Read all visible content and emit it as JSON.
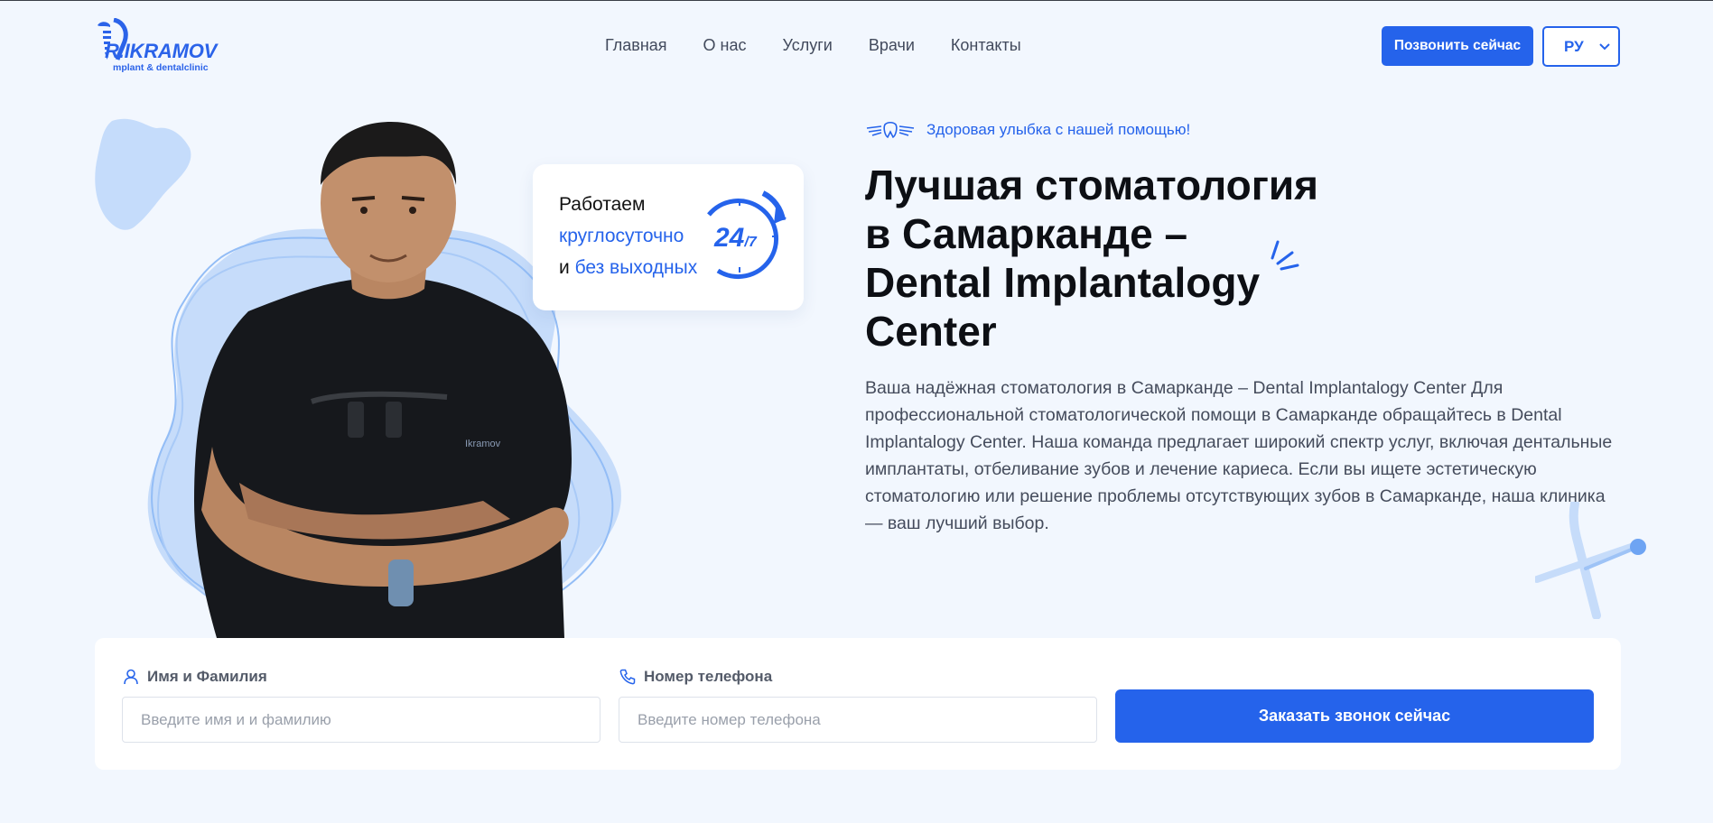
{
  "brand": {
    "name": "R.IKRAMOV",
    "tagline": "mplant & dentalclinic"
  },
  "nav": {
    "items": [
      {
        "label": "Главная"
      },
      {
        "label": "О нас"
      },
      {
        "label": "Услуги"
      },
      {
        "label": "Врачи"
      },
      {
        "label": "Контакты"
      }
    ]
  },
  "header": {
    "call_label": "Позвонить сейчас",
    "language": "РУ"
  },
  "badge": {
    "line1": "Работаем",
    "line2": "круглосуточно",
    "line3_prefix": "и ",
    "line3_highlight": "без выходных",
    "num_main": "24",
    "num_sub": "/7"
  },
  "hero": {
    "tagline": "Здоровая улыбка с нашей помощью!",
    "title_l1": "Лучшая стоматология",
    "title_l2": "в Самарканде –",
    "title_l3": "Dental Implantalogy",
    "title_l4": "Center",
    "description": "Ваша надёжная стоматология в Самарканде – Dental Implantalogy Center Для профессиональной стоматологической помощи в Самарканде обращайтесь в Dental Implantalogy Center. Наша команда предлагает широкий спектр услуг, включая дентальные имплантаты, отбеливание зубов и лечение кариеса. Если вы ищете эстетическую стоматологию или решение проблемы отсутствующих зубов в Самарканде, наша клиника — ваш лучший выбор."
  },
  "form": {
    "name_label": "Имя и Фамилия",
    "name_placeholder": "Введите имя и и фамилию",
    "phone_label": "Номер телефона",
    "phone_placeholder": "Введите номер телефона",
    "submit_label": "Заказать звонок сейчас"
  },
  "colors": {
    "accent": "#2563eb",
    "background": "#f2f7fe",
    "light_blue": "#c9defb"
  }
}
